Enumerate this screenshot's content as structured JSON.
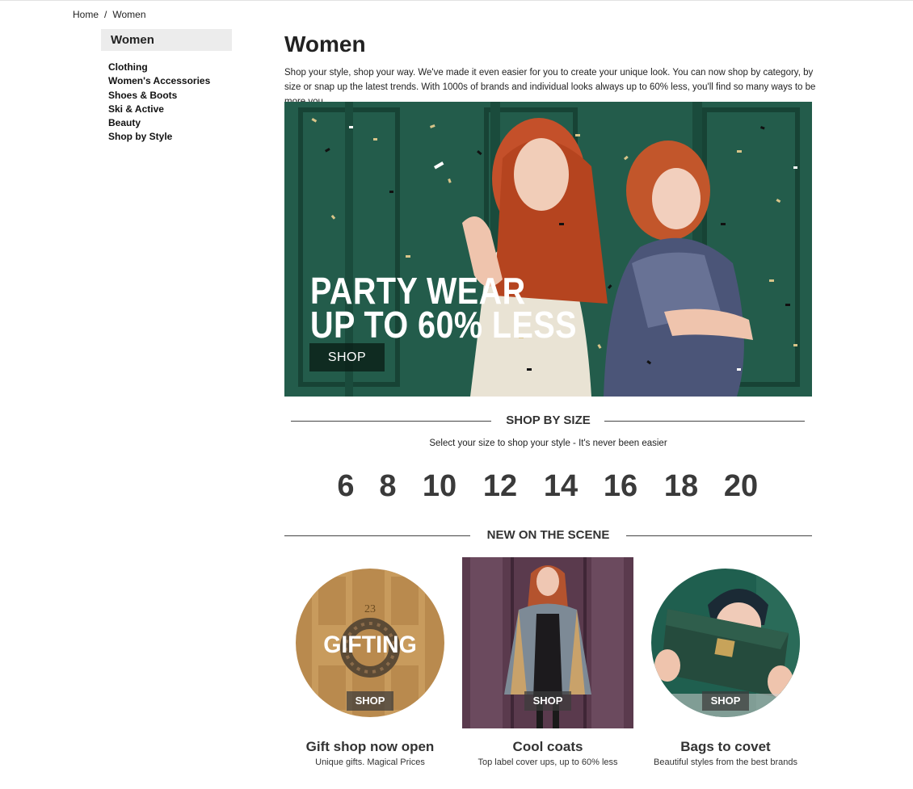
{
  "breadcrumb": {
    "home": "Home",
    "separator": "/",
    "current": "Women"
  },
  "sidebar": {
    "title": "Women",
    "items": [
      {
        "label": "Clothing"
      },
      {
        "label": "Women's Accessories"
      },
      {
        "label": "Shoes & Boots"
      },
      {
        "label": "Ski & Active"
      },
      {
        "label": "Beauty"
      },
      {
        "label": "Shop by Style"
      }
    ]
  },
  "main": {
    "title": "Women",
    "intro": "Shop your style, shop your way. We've made it even easier for you to create your unique look. You can now shop by category, by size or snap up the latest trends. With 1000s of brands and individual looks always up to 60% less, you'll find so many ways to be more you."
  },
  "hero": {
    "line1": "PARTY WEAR",
    "line2": "UP TO 60% LESS",
    "button": "SHOP",
    "colors": {
      "background": "#2b6a56",
      "hair": "#c4502a"
    }
  },
  "size_section": {
    "heading": "SHOP BY SIZE",
    "subtitle": "Select your size to shop your style - It's never been easier",
    "sizes": [
      "6",
      "8",
      "10",
      "12",
      "14",
      "16",
      "18",
      "20"
    ]
  },
  "new_section": {
    "heading": "NEW ON THE SCENE",
    "cards": [
      {
        "overlay": "GIFTING",
        "door_number": "23",
        "button": "SHOP",
        "title": "Gift shop now open",
        "subtitle": "Unique gifts. Magical Prices",
        "image": "door-wreath"
      },
      {
        "button": "SHOP",
        "title": "Cool coats",
        "subtitle": "Top label cover ups, up to 60% less",
        "image": "fur-coat-model"
      },
      {
        "button": "SHOP",
        "title": "Bags to covet",
        "subtitle": "Beautiful styles from the best brands",
        "image": "green-clutch-bag"
      }
    ]
  }
}
